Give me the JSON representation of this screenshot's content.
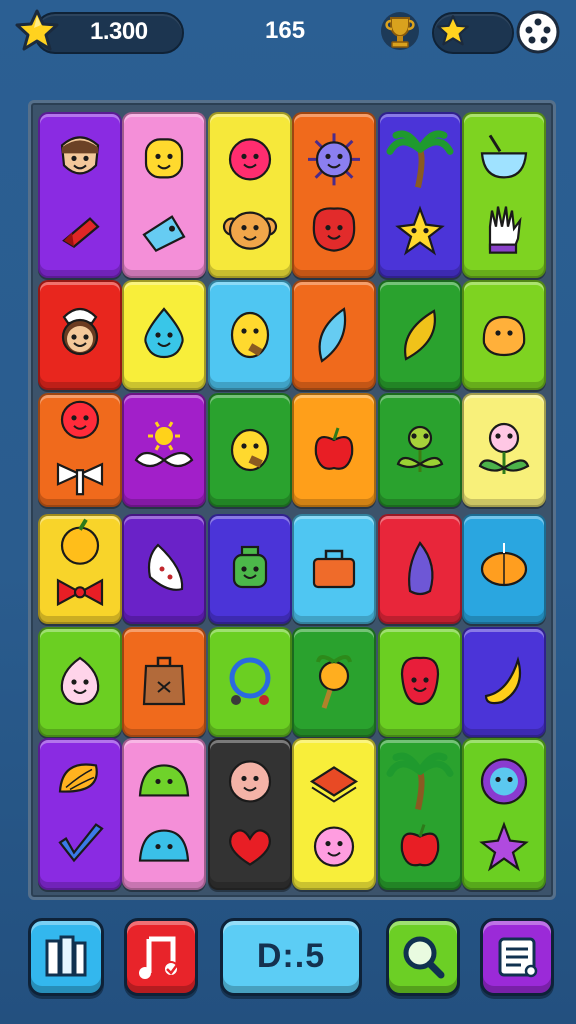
{
  "hud": {
    "score_value": "1.300",
    "center_value": "165",
    "icons": {
      "score": "star-icon",
      "trophy": "trophy-icon",
      "rating": "star-icon",
      "menu": "dots-menu-icon"
    }
  },
  "board": {
    "rows": 6,
    "columns": 6,
    "tiles": [
      {
        "color": "#8a2be2",
        "top": "face-man",
        "bottom": "red-ribbon"
      },
      {
        "color": "#f48fd8",
        "top": "yellow-blob",
        "bottom": "blue-tag"
      },
      {
        "color": "#f6e83a",
        "top": "pink-ball",
        "bottom": "monkey-face"
      },
      {
        "color": "#f06a1c",
        "top": "purple-sun",
        "bottom": "red-creature"
      },
      {
        "color": "#4b34d8",
        "top": "palm-tree",
        "bottom": "yellow-star"
      },
      {
        "color": "#7ed321",
        "top": "blue-bowl",
        "bottom": "white-glove"
      },
      {
        "color": "#e8261e",
        "top": "cook-woman",
        "bottom": ""
      },
      {
        "color": "#f8ee3a",
        "top": "blue-drop-face",
        "bottom": ""
      },
      {
        "color": "#4fc6f2",
        "top": "yellow-lemon-face",
        "bottom": ""
      },
      {
        "color": "#f06a1c",
        "top": "blue-leaf",
        "bottom": ""
      },
      {
        "color": "#2aa22e",
        "top": "yellow-leaf",
        "bottom": ""
      },
      {
        "color": "#7ed321",
        "top": "orange-blob",
        "bottom": ""
      },
      {
        "color": "#f06a1c",
        "top": "red-lollipop",
        "bottom": "white-bow"
      },
      {
        "color": "#a21fc9",
        "top": "sun-bird",
        "bottom": ""
      },
      {
        "color": "#2aa22e",
        "top": "yellow-chick",
        "bottom": ""
      },
      {
        "color": "#ff9f1a",
        "top": "red-apple",
        "bottom": ""
      },
      {
        "color": "#2aa22e",
        "top": "green-sprout",
        "bottom": ""
      },
      {
        "color": "#f8f07a",
        "top": "pink-flower",
        "bottom": ""
      },
      {
        "color": "#f8d42a",
        "top": "yellow-apple",
        "bottom": "red-bow"
      },
      {
        "color": "#6a22c8",
        "top": "white-feather",
        "bottom": ""
      },
      {
        "color": "#4b34d8",
        "top": "green-robot",
        "bottom": ""
      },
      {
        "color": "#4fc6f2",
        "top": "orange-bag",
        "bottom": ""
      },
      {
        "color": "#e8263a",
        "top": "purple-crystal",
        "bottom": ""
      },
      {
        "color": "#2aa6e0",
        "top": "orange-pumpkin",
        "bottom": ""
      },
      {
        "color": "#6bcf22",
        "top": "pink-ghost",
        "bottom": ""
      },
      {
        "color": "#f06a1c",
        "top": "brown-sack",
        "bottom": ""
      },
      {
        "color": "#6bcf22",
        "top": "blue-ring",
        "bottom": ""
      },
      {
        "color": "#2aa22e",
        "top": "orange-fruit-stick",
        "bottom": ""
      },
      {
        "color": "#6bcf22",
        "top": "red-raspberry",
        "bottom": ""
      },
      {
        "color": "#4b34d8",
        "top": "yellow-banana",
        "bottom": ""
      },
      {
        "color": "#8a2be2",
        "top": "orange-shell",
        "bottom": "blue-check"
      },
      {
        "color": "#f48fd8",
        "top": "green-slime",
        "bottom": "blue-slime"
      },
      {
        "color": "#333333",
        "top": "pink-face",
        "bottom": "red-heart"
      },
      {
        "color": "#f8ee3a",
        "top": "red-stack",
        "bottom": "pink-creature"
      },
      {
        "color": "#2aa22e",
        "top": "palm-tree",
        "bottom": "red-apple"
      },
      {
        "color": "#6bcf22",
        "top": "blue-face-ring",
        "bottom": "purple-star"
      }
    ]
  },
  "controls": {
    "timer_label": "D:.5",
    "buttons": [
      {
        "name": "book-button",
        "icon": "bookshelf-icon",
        "color": "#33b7ee"
      },
      {
        "name": "music-button",
        "icon": "music-note-icon",
        "color": "#e8242a"
      },
      {
        "name": "search-button",
        "icon": "magnifier-icon",
        "color": "#6ccf25"
      },
      {
        "name": "list-button",
        "icon": "list-icon",
        "color": "#9b2ad8"
      }
    ]
  }
}
